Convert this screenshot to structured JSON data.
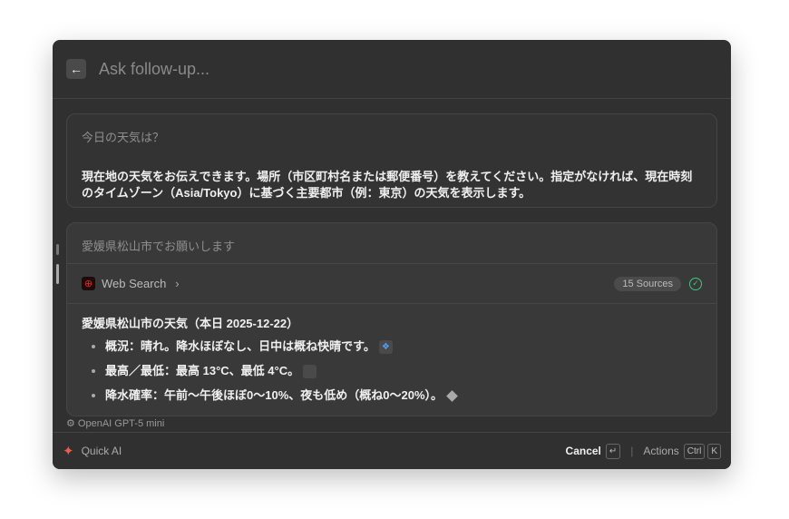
{
  "header": {
    "placeholder": "Ask follow-up...",
    "back_icon": "arrow-left-icon"
  },
  "messages": [
    {
      "question": "今日の天気は？",
      "answer": "現在地の天気をお伝えできます。場所（市区町村名または郵便番号）を教えてください。指定がなければ、現在時刻のタイムゾーン（Asia/Tokyo）に基づく主要都市（例：東京）の天気を表示します。"
    },
    {
      "question": "愛媛県松山市でお願いします",
      "tool": {
        "label": "Web Search",
        "sources": "15 Sources",
        "status": "complete"
      },
      "title": "愛媛県松山市の天気（本日 2025-12-22）",
      "bullets": [
        "概況：晴れ。降水ほぼなし、日中は概ね快晴です。",
        "最高／最低：最高 13°C、最低 4°C。",
        "降水確率：午前〜午後ほぼ0〜10%、夜も低め（概ね0〜20%）。"
      ]
    }
  ],
  "model": "OpenAI GPT-5 mini",
  "footer": {
    "app": "Quick AI",
    "cancel": "Cancel",
    "enter_key": "↵",
    "actions": "Actions",
    "key_ctrl": "Ctrl",
    "key_k": "K"
  },
  "colors": {
    "accent": "#f05a4a",
    "success": "#3fc77f"
  }
}
